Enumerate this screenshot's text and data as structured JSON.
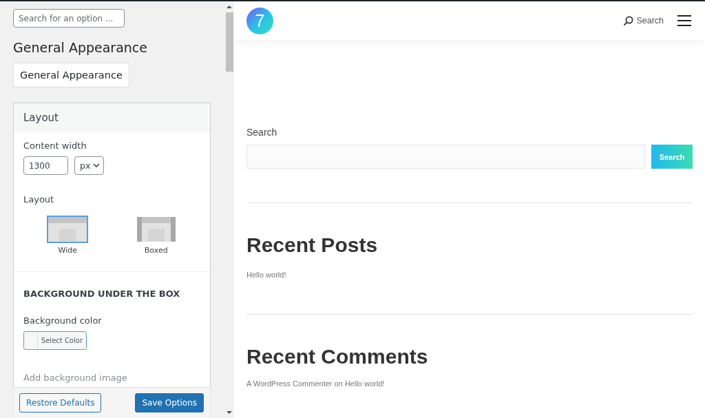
{
  "options_panel": {
    "search": {
      "placeholder": "Search for an option ..."
    },
    "heading": "General Appearance",
    "section_tab": "General Appearance",
    "card": {
      "title": "Layout",
      "content_width": {
        "label": "Content width",
        "value": "1300",
        "unit": "px"
      },
      "layout": {
        "label": "Layout",
        "options": [
          {
            "label": "Wide",
            "kind": "wide",
            "selected": true
          },
          {
            "label": "Boxed",
            "kind": "boxed",
            "selected": false
          }
        ]
      },
      "background_heading": "BACKGROUND UNDER THE BOX",
      "background_color": {
        "label": "Background color",
        "button": "Select Color"
      },
      "next_label": "Add background image"
    },
    "buttons": [
      {
        "label": "Restore Defaults",
        "kind": "secondary"
      },
      {
        "label": "Save Options",
        "kind": "primary"
      }
    ]
  },
  "preview": {
    "logo": "7",
    "header_search": "Search",
    "search_widget": {
      "label": "Search",
      "button": "Search"
    },
    "sections": [
      {
        "title": "Recent Posts",
        "items": [
          {
            "kind": "link",
            "text": "Hello world!"
          }
        ]
      },
      {
        "title": "Recent Comments",
        "items": [
          {
            "kind": "comment",
            "author": "A WordPress Commenter",
            "joiner": "on",
            "post": "Hello world!"
          }
        ]
      }
    ]
  }
}
